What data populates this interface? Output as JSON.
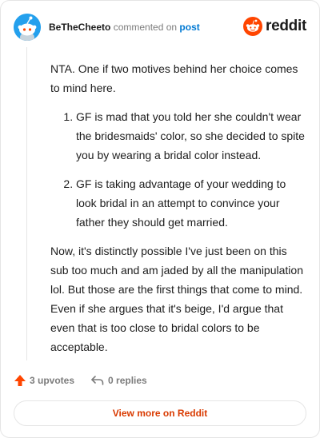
{
  "header": {
    "username": "BeTheCheeto",
    "action_text": "commented on",
    "post_link": "post",
    "brand": "reddit"
  },
  "comment": {
    "intro": "NTA. One if two motives behind her choice comes to mind here.",
    "list": [
      "GF is mad that you told her she couldn't wear the bridesmaids' color, so she decided to spite you by wearing a bridal color instead.",
      "GF is taking advantage of your wedding to look bridal in an attempt to convince your father they should get married."
    ],
    "outro": "Now, it's distinctly possible I've just been on this sub too much and am jaded by all the manipulation lol. But those are the first things that come to mind. Even if she argues that it's beige, I'd argue that even that is too close to bridal colors to be acceptable."
  },
  "actions": {
    "upvotes": "3 upvotes",
    "replies": "0 replies"
  },
  "view_more": "View more on Reddit",
  "colors": {
    "accent": "#d93a00",
    "upvote": "#ff4500",
    "link": "#0079d3",
    "avatar_bg": "#24a0ed",
    "reddit_orange": "#ff4500"
  },
  "icons": {
    "avatar": "snoo-avatar-icon",
    "brand": "reddit-logo-icon",
    "upvote": "upvote-arrow-icon",
    "reply": "reply-arrow-icon"
  }
}
